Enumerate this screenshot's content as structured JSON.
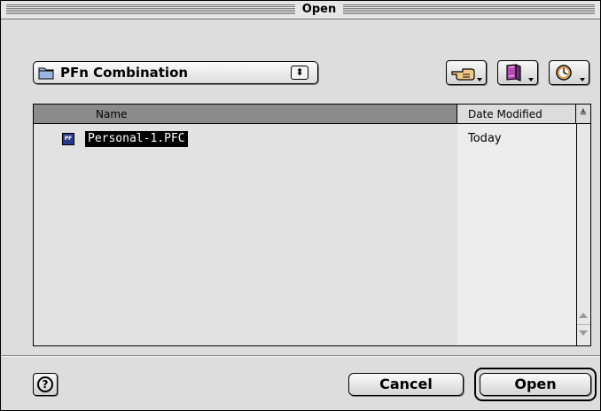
{
  "window": {
    "title": "Open"
  },
  "location_popup": {
    "label": "PFn Combination",
    "icon": "folder-icon"
  },
  "toolbar": {
    "buttons": [
      {
        "name": "shortcuts-button",
        "icon": "pointing-hand-icon"
      },
      {
        "name": "favorites-button",
        "icon": "book-icon"
      },
      {
        "name": "recent-button",
        "icon": "clock-icon"
      }
    ]
  },
  "file_list": {
    "columns": {
      "name": "Name",
      "date": "Date Modified",
      "sort_indicator": "≜"
    },
    "items": [
      {
        "icon_text": "PF",
        "name": "Personal-1.PFC",
        "date": "Today",
        "selected": true
      }
    ]
  },
  "buttons": {
    "cancel": "Cancel",
    "open": "Open",
    "help": "?"
  },
  "colors": {
    "selection": "#000000",
    "file_icon": "#2a3a8a",
    "window_bg": "#dddddd"
  }
}
